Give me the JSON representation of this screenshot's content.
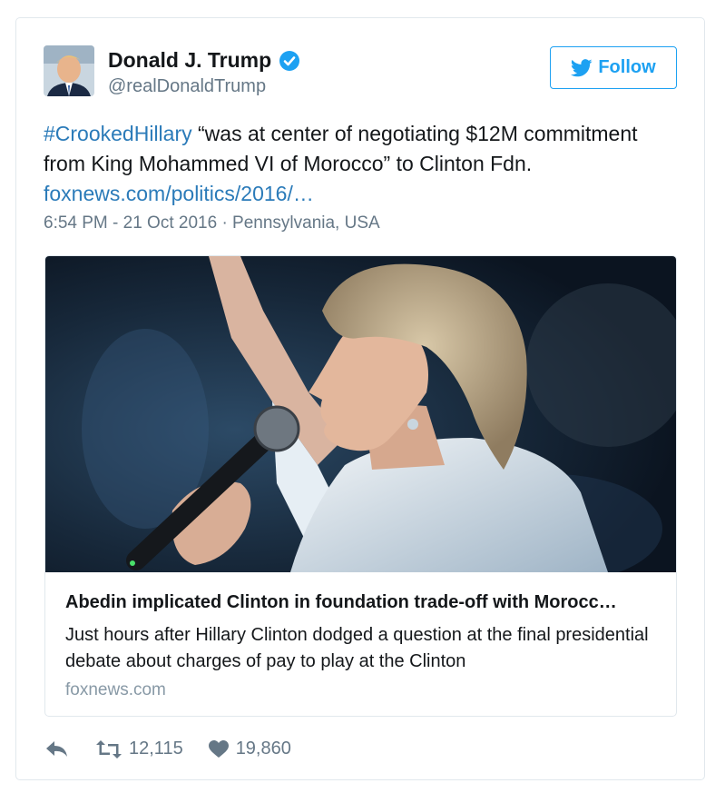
{
  "user": {
    "name": "Donald J. Trump",
    "handle": "@realDonaldTrump",
    "verified": true
  },
  "follow_button": {
    "label": "Follow"
  },
  "tweet": {
    "hashtag": "#CrookedHillary",
    "text_body": " “was at center of negotiating $12M commitment from King Mohammed VI of Morocco” to Clinton Fdn. ",
    "link": "foxnews.com/politics/2016/…",
    "timestamp": "6:54 PM - 21 Oct 2016 · Pennsylvania, USA"
  },
  "card": {
    "title": "Abedin implicated Clinton in foundation trade-off with Morocc…",
    "description": "Just hours after Hillary Clinton dodged a question at the final presidential debate about charges of pay to play at the Clinton",
    "domain": "foxnews.com"
  },
  "actions": {
    "retweets": "12,115",
    "likes": "19,860"
  },
  "colors": {
    "link": "#2b7bb9",
    "brand_blue": "#1da1f2",
    "muted": "#657786",
    "border": "#e1e8ed"
  },
  "icons": {
    "reply": "reply-icon",
    "retweet": "retweet-icon",
    "like": "heart-icon",
    "verified": "verified-badge-icon",
    "bird": "twitter-bird-icon"
  }
}
